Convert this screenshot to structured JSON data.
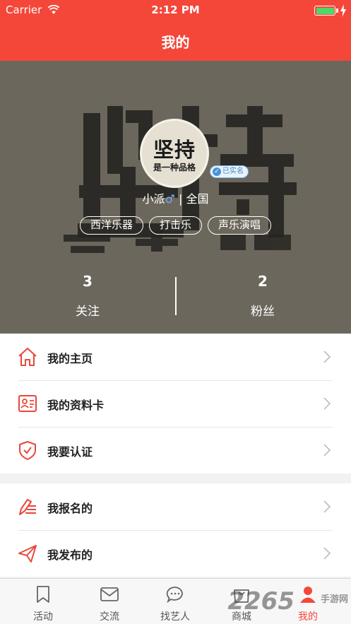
{
  "status_bar": {
    "carrier": "Carrier",
    "time": "2:12 PM"
  },
  "nav": {
    "title": "我的"
  },
  "profile": {
    "avatar_text_large": "坚持",
    "avatar_text_small": "是一种品格",
    "verified_badge": "已实名",
    "name": "小派",
    "gender_symbol": "♂",
    "separator": "|",
    "region": "全国",
    "tags": [
      "西洋乐器",
      "打击乐",
      "声乐演唱"
    ],
    "stats": {
      "following": {
        "count": "3",
        "label": "关注"
      },
      "followers": {
        "count": "2",
        "label": "粉丝"
      }
    }
  },
  "menu_group_1": [
    {
      "label": "我的主页",
      "icon": "home-icon"
    },
    {
      "label": "我的资料卡",
      "icon": "profile-card-icon"
    },
    {
      "label": "我要认证",
      "icon": "shield-check-icon"
    }
  ],
  "menu_group_2": [
    {
      "label": "我报名的",
      "icon": "signup-pen-icon"
    },
    {
      "label": "我发布的",
      "icon": "paper-plane-icon"
    }
  ],
  "tab_bar": [
    {
      "label": "活动",
      "icon": "bookmark-icon"
    },
    {
      "label": "交流",
      "icon": "mail-icon"
    },
    {
      "label": "找艺人",
      "icon": "chat-bubble-icon"
    },
    {
      "label": "商城",
      "icon": "shopping-bag-icon"
    },
    {
      "label": "我的",
      "icon": "person-icon",
      "active": true
    }
  ],
  "watermark": {
    "brand": "2265",
    "text": "手游网"
  },
  "colors": {
    "accent": "#f4473a",
    "verified_blue": "#4b93d6",
    "battery_green": "#4cd964"
  }
}
